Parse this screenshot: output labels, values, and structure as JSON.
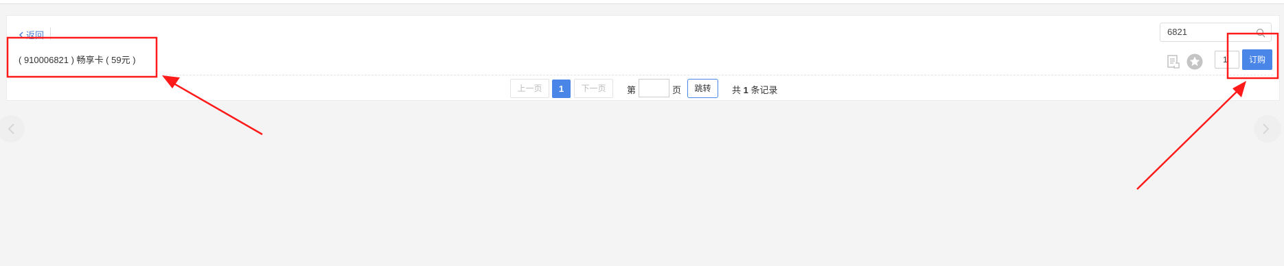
{
  "header": {
    "back_label": "返回"
  },
  "product": {
    "title": "( 910006821 ) 畅享卡 ( 59元 )"
  },
  "search": {
    "value": "6821",
    "icon": "search-icon"
  },
  "actions": {
    "doc_icon": "document-icon",
    "star_icon": "star-icon",
    "quantity": "1",
    "subscribe_label": "订购"
  },
  "pagination": {
    "prev_label": "上一页",
    "current_page": "1",
    "next_label": "下一页",
    "page_prefix": "第",
    "page_suffix": "页",
    "jump_label": "跳转",
    "total_prefix": "共",
    "total_count": "1",
    "total_suffix": "条记录"
  },
  "colors": {
    "primary": "#4a86e8",
    "annotation": "#ff1a1a",
    "background": "#f4f4f4"
  }
}
